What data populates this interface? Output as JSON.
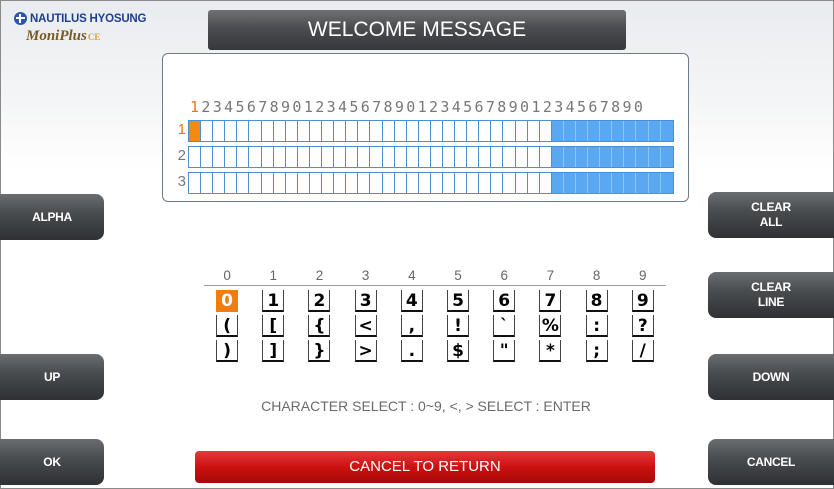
{
  "logo": {
    "brand": "NAUTILUS HYOSUNG",
    "product": "MoniPlus",
    "suffix": "CE"
  },
  "header": {
    "title": "WELCOME MESSAGE"
  },
  "grid": {
    "column_numbers": "1234567890123456789012345678901234567890",
    "rows": [
      {
        "label": "1",
        "active": true
      },
      {
        "label": "2",
        "active": false
      },
      {
        "label": "3",
        "active": false
      }
    ],
    "columns": 40,
    "highlighted_from_column": 31,
    "cursor": {
      "row": 1,
      "column": 1
    }
  },
  "keyboard": {
    "headers": [
      "0",
      "1",
      "2",
      "3",
      "4",
      "5",
      "6",
      "7",
      "8",
      "9"
    ],
    "rows": [
      [
        "0",
        "1",
        "2",
        "3",
        "4",
        "5",
        "6",
        "7",
        "8",
        "9"
      ],
      [
        "(",
        "[",
        "{",
        "<",
        ",",
        "!",
        "`",
        "%",
        ":",
        "?"
      ],
      [
        ")",
        "]",
        "}",
        ">",
        ".",
        "$",
        "\"",
        "*",
        ";",
        "/"
      ]
    ],
    "selected": {
      "row": 0,
      "column": 0
    },
    "hint": "CHARACTER SELECT : 0~9, <, >  SELECT : ENTER"
  },
  "buttons": {
    "alpha": "ALPHA",
    "up": "UP",
    "ok": "OK",
    "clear_all": "CLEAR\nALL",
    "clear_line": "CLEAR\nLINE",
    "down": "DOWN",
    "cancel": "CANCEL",
    "cancel_to_return": "CANCEL TO RETURN"
  }
}
